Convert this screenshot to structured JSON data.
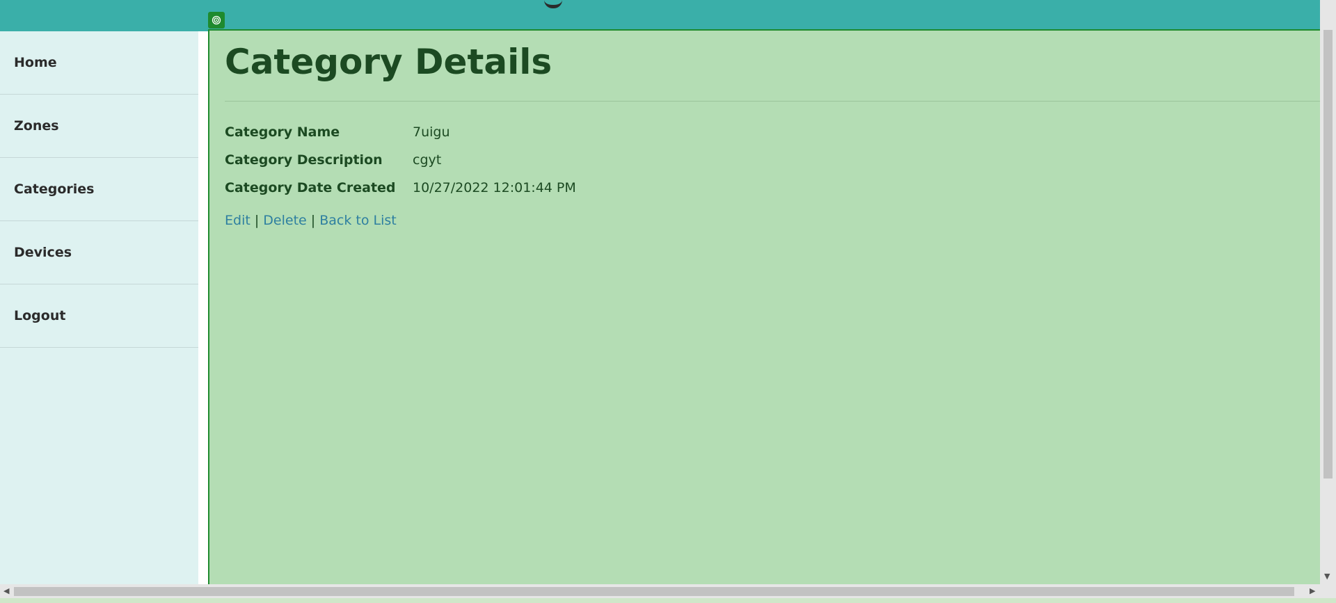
{
  "sidebar": {
    "items": [
      {
        "label": "Home"
      },
      {
        "label": "Zones"
      },
      {
        "label": "Categories"
      },
      {
        "label": "Devices"
      },
      {
        "label": "Logout"
      }
    ]
  },
  "page": {
    "title": "Category Details",
    "details": [
      {
        "label": "Category Name",
        "value": "7uigu"
      },
      {
        "label": "Category Description",
        "value": "cgyt"
      },
      {
        "label": "Category Date Created",
        "value": "10/27/2022 12:01:44 PM"
      }
    ],
    "actions": {
      "edit": "Edit",
      "delete": "Delete",
      "back": "Back to List",
      "separator": "|"
    }
  },
  "icons": {
    "badge": "target-icon",
    "scroll_down": "chevron-down-icon",
    "scroll_left": "chevron-left-icon",
    "scroll_right": "chevron-right-icon"
  },
  "colors": {
    "header": "#3aafa9",
    "sidebar": "#def2f1",
    "content_highlight": "#b4ddb4",
    "highlight_border": "#1e8a2e",
    "link": "#2e7fa0"
  }
}
